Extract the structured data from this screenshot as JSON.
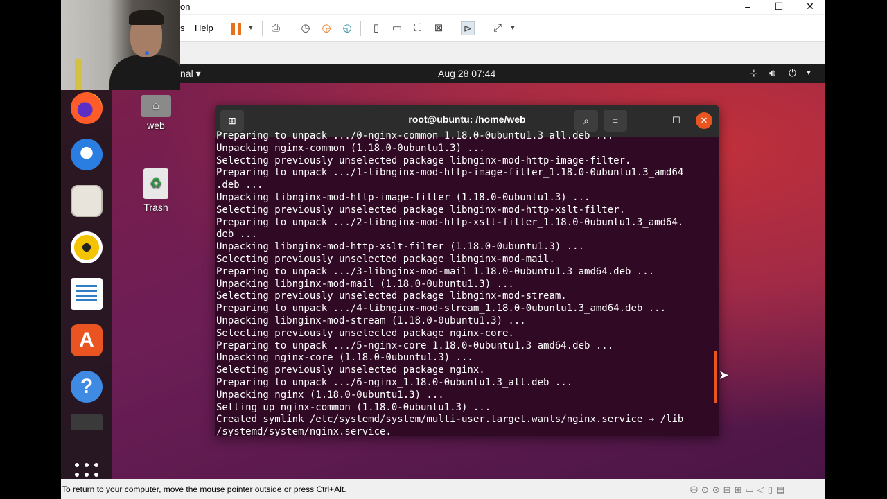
{
  "window": {
    "title_fragment": "on",
    "minimize": "–",
    "maximize": "☐",
    "close": "✕"
  },
  "toolbar": {
    "menu_fragment": "s",
    "help_label": "Help"
  },
  "guest_topbar": {
    "activities_fragment": "nal ▾",
    "clock": "Aug 28  07:44"
  },
  "desktop": {
    "home_label": "web",
    "trash_label": "Trash"
  },
  "terminal": {
    "title": "root@ubuntu: /home/web",
    "lines": [
      "Preparing to unpack .../0-nginx-common_1.18.0-0ubuntu1.3_all.deb ...",
      "Unpacking nginx-common (1.18.0-0ubuntu1.3) ...",
      "Selecting previously unselected package libnginx-mod-http-image-filter.",
      "Preparing to unpack .../1-libnginx-mod-http-image-filter_1.18.0-0ubuntu1.3_amd64",
      ".deb ...",
      "Unpacking libnginx-mod-http-image-filter (1.18.0-0ubuntu1.3) ...",
      "Selecting previously unselected package libnginx-mod-http-xslt-filter.",
      "Preparing to unpack .../2-libnginx-mod-http-xslt-filter_1.18.0-0ubuntu1.3_amd64.",
      "deb ...",
      "Unpacking libnginx-mod-http-xslt-filter (1.18.0-0ubuntu1.3) ...",
      "Selecting previously unselected package libnginx-mod-mail.",
      "Preparing to unpack .../3-libnginx-mod-mail_1.18.0-0ubuntu1.3_amd64.deb ...",
      "Unpacking libnginx-mod-mail (1.18.0-0ubuntu1.3) ...",
      "Selecting previously unselected package libnginx-mod-stream.",
      "Preparing to unpack .../4-libnginx-mod-stream_1.18.0-0ubuntu1.3_amd64.deb ...",
      "Unpacking libnginx-mod-stream (1.18.0-0ubuntu1.3) ...",
      "Selecting previously unselected package nginx-core.",
      "Preparing to unpack .../5-nginx-core_1.18.0-0ubuntu1.3_amd64.deb ...",
      "Unpacking nginx-core (1.18.0-0ubuntu1.3) ...",
      "Selecting previously unselected package nginx.",
      "Preparing to unpack .../6-nginx_1.18.0-0ubuntu1.3_all.deb ...",
      "Unpacking nginx (1.18.0-0ubuntu1.3) ...",
      "Setting up nginx-common (1.18.0-0ubuntu1.3) ...",
      "Created symlink /etc/systemd/system/multi-user.target.wants/nginx.service → /lib",
      "/systemd/system/nginx.service."
    ]
  },
  "statusbar": {
    "message": "To return to your computer, move the mouse pointer outside or press Ctrl+Alt."
  },
  "colors": {
    "accent": "#e95420",
    "terminal_bg": "#300a24"
  }
}
